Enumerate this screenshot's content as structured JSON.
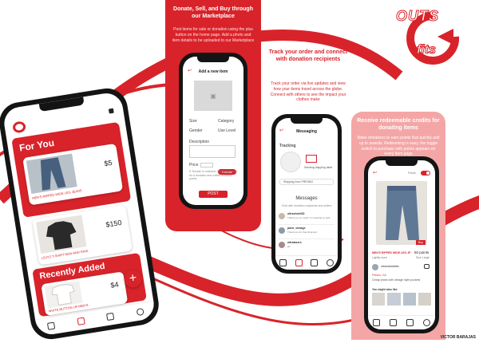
{
  "brand": {
    "logo_text_top": "OUTS",
    "logo_text_bottom": "fits",
    "credit": "VICTOR BARAJAS",
    "accent_color": "#d8232a",
    "light_accent_color": "#f4a6a6"
  },
  "panels": {
    "donate": {
      "title": "Donate, Sell, and Buy through our Marketplace",
      "body": "Post items for sale or donation using the plus button on the home page. Add a photo and item details to be uploaded to our Marketplace"
    },
    "track": {
      "title": "Track your order and connect with donation recipients",
      "body": "Track your order via live updates and view how your items travel across the globe. Connect with others to see the impact your clothes make"
    },
    "credits": {
      "title": "Receive redeemable credits for donating items",
      "body": "Make donations to earn points that quickly add up to awards. Redeeming is easy, the toggle switch to purchase with points appears on every item page"
    }
  },
  "phone_home": {
    "for_you_title": "For You",
    "item1": {
      "price": "$5",
      "caption": "MEN'S RIPPED WIDE LEG JEANS"
    },
    "item2": {
      "price": "$150",
      "caption": "LEVI'S T-SHIRT NEW AND RAIN"
    },
    "recently_added_title": "Recently Added",
    "item3": {
      "price": "$4",
      "caption": "WHITE BUTTON UP MEN'S"
    },
    "add_label": "+"
  },
  "phone_add": {
    "header": "Add a new item",
    "size_label": "Size",
    "category_label": "Category",
    "gender_label": "Gender",
    "use_level_label": "Use Level",
    "description_label": "Description",
    "price_label": "Price",
    "donate_label": "Donate",
    "notice": "If 'Donate' is selected, item will be sold for a donation and collect donation points",
    "post_label": "POST"
  },
  "phone_track": {
    "header": "Messaging",
    "tracking_label": "Tracking",
    "status_text": "Sending shipping label",
    "shipping_from": "Shipping from FRESNO",
    "messages_title": "Messages",
    "messages_sub": "Chat with donation recipients and sellers",
    "messages": [
      {
        "name": "ultravioletXD",
        "text": "Thank you so much! I'm wearing so well"
      },
      {
        "name": "paris_vintage",
        "text": "Thank you for that shipment"
      },
      {
        "name": "ultralasers",
        "text": "Hi!"
      }
    ]
  },
  "phone_item": {
    "toggle_label": "Points",
    "tag_label": "Buy",
    "title": "MEN'S RIPPED WIDE LEG JP",
    "condition": "Lightly used",
    "points": "50 points",
    "size": "Size Large",
    "seller": "urbanaesthetic",
    "location": "Fresno, CA",
    "desc": "Cheap jeans with vintage style pockets",
    "similar_label": "You might also like"
  }
}
